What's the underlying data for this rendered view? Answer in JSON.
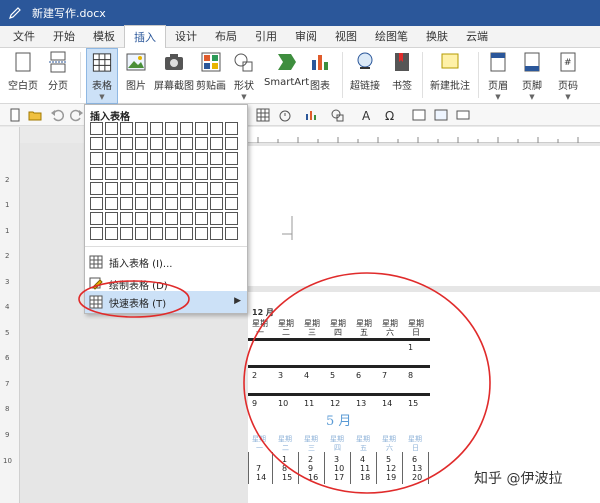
{
  "window": {
    "title": "新建写作.docx"
  },
  "tabs": [
    {
      "label": "文件",
      "active": false
    },
    {
      "label": "开始",
      "active": false
    },
    {
      "label": "模板",
      "active": false
    },
    {
      "label": "插入",
      "active": true
    },
    {
      "label": "设计",
      "active": false
    },
    {
      "label": "布局",
      "active": false
    },
    {
      "label": "引用",
      "active": false
    },
    {
      "label": "审阅",
      "active": false
    },
    {
      "label": "视图",
      "active": false
    },
    {
      "label": "绘图笔",
      "active": false
    },
    {
      "label": "换肤",
      "active": false
    },
    {
      "label": "云端",
      "active": false
    }
  ],
  "ribbon": {
    "blank_page": "空白页",
    "page_break": "分页",
    "table": "表格",
    "picture": "图片",
    "screenshot": "屏幕截图",
    "clipart": "剪贴画",
    "shapes": "形状",
    "smartart": "SmartArt",
    "chart": "图表",
    "hyperlink": "超链接",
    "bookmark": "书签",
    "new_comment": "新建批注",
    "header": "页眉",
    "footer": "页脚",
    "page_number": "页码"
  },
  "dropdown": {
    "title": "插入表格",
    "items": [
      {
        "label": "插入表格 (I)..."
      },
      {
        "label": "绘制表格 (D)"
      },
      {
        "label": "快速表格 (T)"
      }
    ]
  },
  "calendar": {
    "month_label": "12 月",
    "weekdays_top": [
      "星期",
      "星期",
      "星期",
      "星期",
      "星期",
      "星期",
      "星期"
    ],
    "weekdays_bottom": [
      "一",
      "二",
      "三",
      "四",
      "五",
      "六",
      "日"
    ],
    "row1": [
      "",
      "",
      "",
      "",
      "",
      "",
      "1"
    ],
    "row2": [
      "2",
      "3",
      "4",
      "5",
      "6",
      "7",
      "8"
    ],
    "row3": [
      "9",
      "10",
      "11",
      "12",
      "13",
      "14",
      "15"
    ],
    "month2": "5 月",
    "weekdays2": [
      "星期",
      "星期",
      "星期",
      "星期",
      "星期",
      "星期",
      "星期"
    ],
    "weekdays2_bottom": [
      "一",
      "二",
      "三",
      "四",
      "五",
      "六",
      "日"
    ],
    "m2_row1": [
      "",
      "1",
      "2",
      "3",
      "4",
      "5",
      "6"
    ],
    "m2_row2": [
      "7",
      "8",
      "9",
      "10",
      "11",
      "12",
      "13"
    ],
    "m2_row3": [
      "14",
      "15",
      "16",
      "17",
      "18",
      "19",
      "20"
    ]
  },
  "watermark": "知乎 @伊波拉",
  "colors": {
    "accent": "#2b579a",
    "highlight": "#cce1f7",
    "annotation": "#e02b2b",
    "month2": "#5b9bd5"
  }
}
